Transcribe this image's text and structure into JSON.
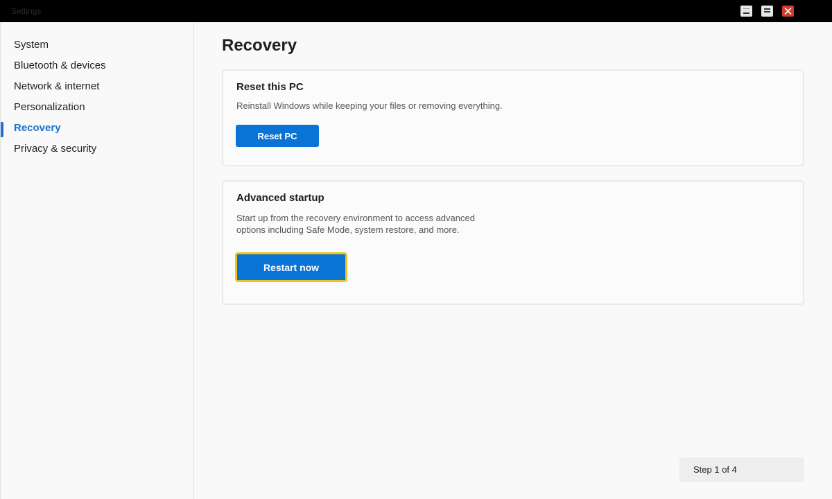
{
  "window": {
    "title": "Settings",
    "controls": {
      "minimize_icon": "minimize-icon",
      "maximize_icon": "maximize-icon",
      "close_icon": "close-icon",
      "close_color": "#d13b2f"
    }
  },
  "sidebar": {
    "items": [
      {
        "label": "System",
        "active": false
      },
      {
        "label": "Bluetooth & devices",
        "active": false
      },
      {
        "label": "Network & internet",
        "active": false
      },
      {
        "label": "Personalization",
        "active": false
      },
      {
        "label": "Recovery",
        "active": true
      },
      {
        "label": "Privacy & security",
        "active": false
      }
    ],
    "active_color": "#1a74cf"
  },
  "main": {
    "page_title": "Recovery",
    "reset_card": {
      "title": "Reset this PC",
      "description": "Reinstall Windows while keeping your files or removing everything.",
      "button_label": "Reset PC"
    },
    "advanced_card": {
      "title": "Advanced startup",
      "description_line1": "Start up from the recovery environment to access advanced",
      "description_line2": "options including Safe Mode, system restore, and more.",
      "button_label": "Restart now",
      "button_highlight_color": "#f0c419"
    },
    "step_indicator": "Step 1 of 4"
  },
  "colors": {
    "accent": "#0a74d6",
    "titlebar": "#000000"
  }
}
